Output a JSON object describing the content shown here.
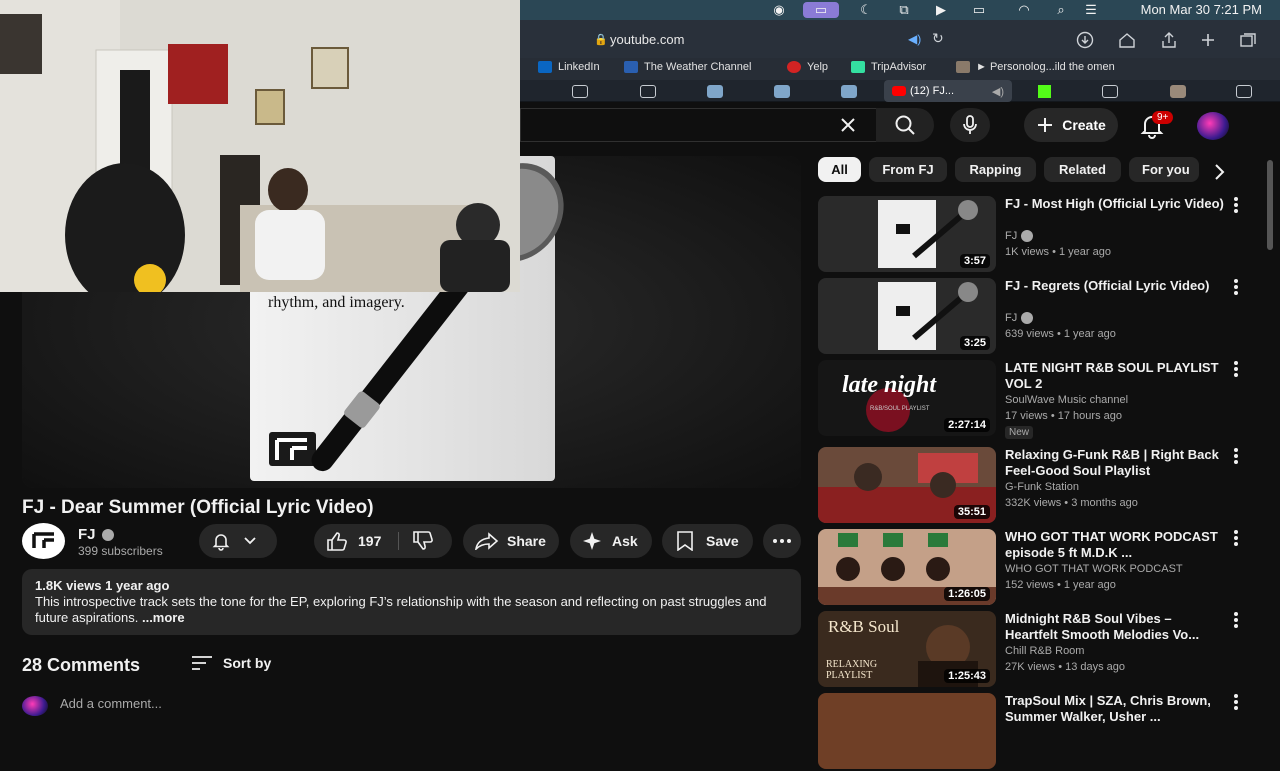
{
  "menubar": {
    "clock": "Mon Mar 30  7:21 PM"
  },
  "safari": {
    "url": "youtube.com",
    "bookmarks": [
      "LinkedIn",
      "The Weather Channel",
      "Yelp",
      "TripAdvisor",
      "► Personolog...ild the omen"
    ],
    "active_tab": "(12) FJ..."
  },
  "header": {
    "create_label": "Create",
    "notifications_badge": "9+"
  },
  "video": {
    "title": "FJ - Dear Summer (Official Lyric Video)",
    "overlay_text": "rhythm, and imagery.",
    "channel": "FJ",
    "subscribers": "399 subscribers",
    "likes": "197",
    "share_label": "Share",
    "ask_label": "Ask",
    "save_label": "Save"
  },
  "description": {
    "meta": "1.8K views  1 year ago",
    "text": "This introspective track sets the tone for the EP, exploring FJ’s relationship with the season and reflecting on past struggles and future aspirations.",
    "more": "...more"
  },
  "comments": {
    "count": "28 Comments",
    "sort_label": "Sort by",
    "add_placeholder": "Add a comment..."
  },
  "chips": [
    "All",
    "From FJ",
    "Rapping",
    "Related",
    "For you"
  ],
  "related": [
    {
      "title": "FJ - Most High (Official Lyric Video)",
      "channel": "FJ",
      "verified": true,
      "meta": "1K views • 1 year ago",
      "duration": "3:57",
      "thumb": "notepad"
    },
    {
      "title": "FJ - Regrets (Official Lyric Video)",
      "channel": "FJ",
      "verified": true,
      "meta": "639 views • 1 year ago",
      "duration": "3:25",
      "thumb": "notepad"
    },
    {
      "title": "LATE NIGHT R&B SOUL PLAYLIST VOL 2",
      "channel": "SoulWave Music channel",
      "verified": false,
      "meta": "17 views • 17 hours ago",
      "badge": "New",
      "duration": "2:27:14",
      "thumb": "latenight",
      "thumb_text": "late night",
      "thumb_sub": "R&B/SOUL PLAYLIST"
    },
    {
      "title": "Relaxing G-Funk R&B | Right Back Feel-Good Soul Playlist",
      "channel": "G-Funk Station",
      "verified": false,
      "meta": "332K views • 3 months ago",
      "duration": "35:51",
      "thumb": "gfunk"
    },
    {
      "title": "WHO GOT THAT WORK PODCAST episode 5 ft M.D.K ...",
      "channel": "WHO GOT THAT WORK PODCAST",
      "verified": false,
      "meta": "152 views • 1 year ago",
      "duration": "1:26:05",
      "thumb": "podcast"
    },
    {
      "title": "Midnight R&B Soul Vibes – Heartfelt Smooth Melodies Vo...",
      "channel": "Chill R&B Room",
      "verified": false,
      "meta": "27K views • 13 days ago",
      "duration": "1:25:43",
      "thumb": "midnight",
      "thumb_text": "R&B Soul",
      "thumb_sub": "RELAXING PLAYLIST"
    },
    {
      "title": "TrapSoul Mix | SZA, Chris Brown, Summer Walker, Usher ...",
      "channel": "",
      "verified": false,
      "meta": "",
      "duration": "",
      "thumb": "trapsoul"
    }
  ],
  "colors": {
    "youtube_red": "#cc0000",
    "background": "#0f0f0f",
    "chip_bg": "#272727"
  }
}
